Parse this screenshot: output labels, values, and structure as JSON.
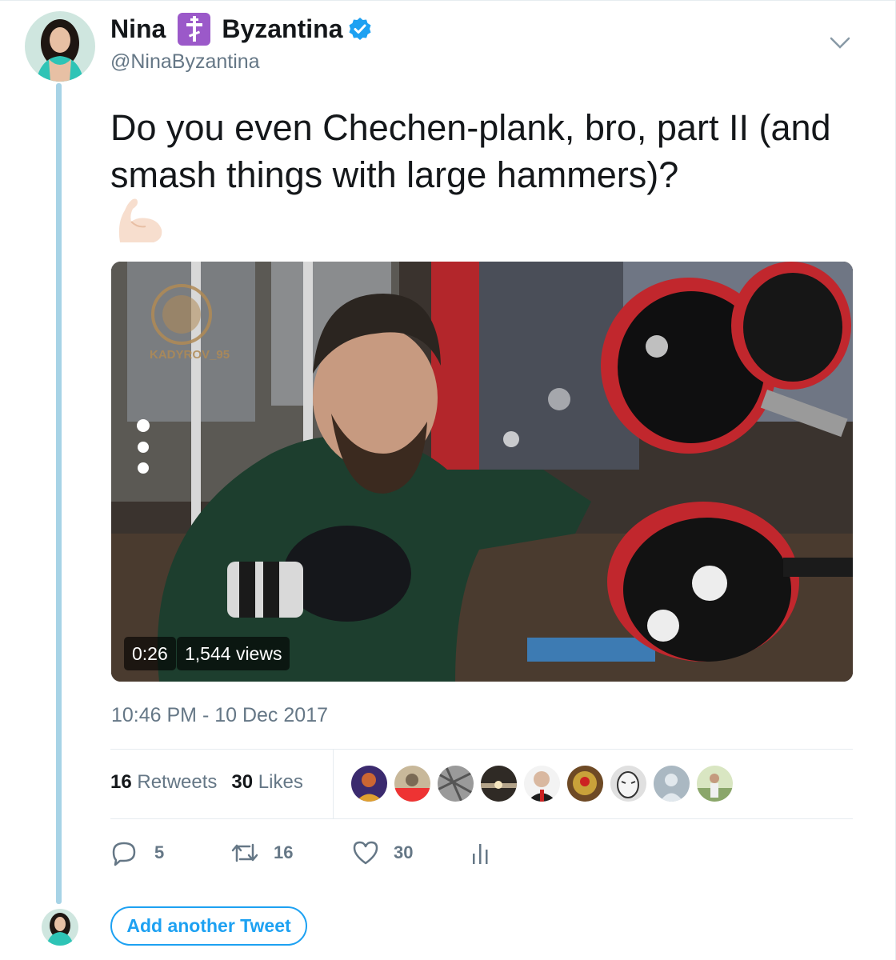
{
  "tweet": {
    "author_name_first": "Nina",
    "author_name_last": "Byzantina",
    "author_handle": "@NinaByzantina",
    "text": "Do you even Chechen-plank, bro, part II (and smash things with large hammers)?",
    "emoji": "flexed-biceps-icon",
    "timestamp": "10:46 PM - 10 Dec 2017"
  },
  "video": {
    "duration": "0:26",
    "views": "1,544 views",
    "watermark": "KADYROV_95"
  },
  "stats": {
    "retweets_count": "16",
    "retweets_label": "Retweets",
    "likes_count": "30",
    "likes_label": "Likes"
  },
  "likers": [
    {
      "name": "liker-avatar-1",
      "color": "#3b2a6e"
    },
    {
      "name": "liker-avatar-2",
      "color": "#c8b89a"
    },
    {
      "name": "liker-avatar-3",
      "color": "#9a9a9a"
    },
    {
      "name": "liker-avatar-4",
      "color": "#2f2a25"
    },
    {
      "name": "liker-avatar-5",
      "color": "#d9b8a0"
    },
    {
      "name": "liker-avatar-6",
      "color": "#c9a23a"
    },
    {
      "name": "liker-avatar-7",
      "color": "#e0e0e0"
    },
    {
      "name": "liker-avatar-8",
      "color": "#aab8c2"
    },
    {
      "name": "liker-avatar-9",
      "color": "#8aa66a"
    }
  ],
  "actions": {
    "reply_count": "5",
    "retweet_count": "16",
    "like_count": "30"
  },
  "composer": {
    "add_tweet_label": "Add another Tweet"
  },
  "colors": {
    "accent": "#1da1f2",
    "thread_line": "#a7d3e6",
    "secondary_text": "#657786"
  }
}
